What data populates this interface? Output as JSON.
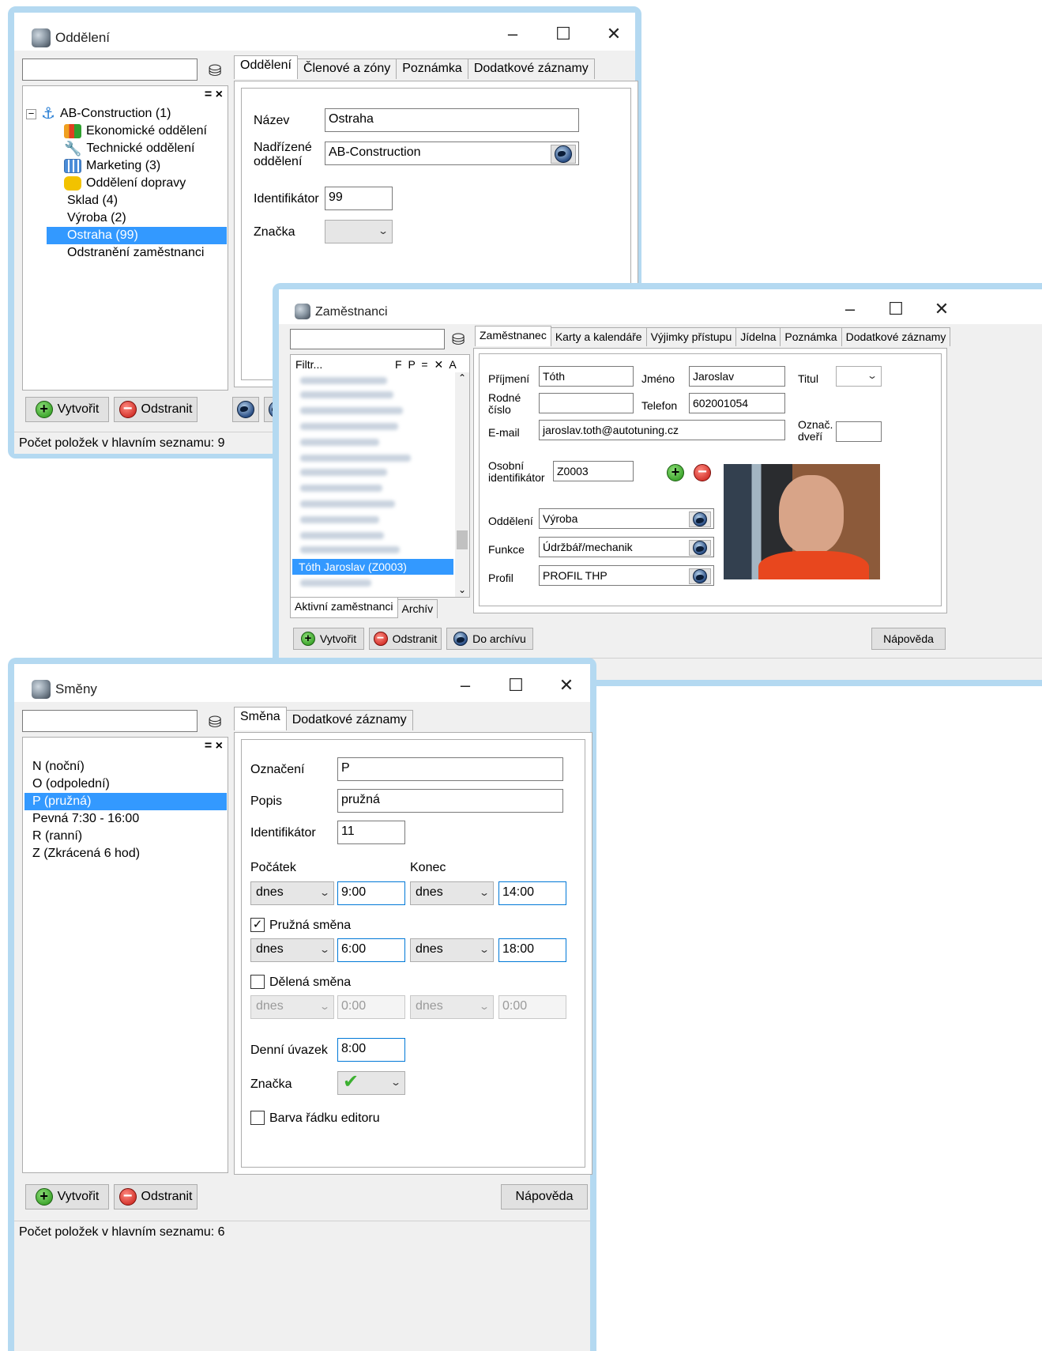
{
  "dept_window": {
    "title": "Oddělení",
    "tabs": [
      "Oddělení",
      "Členové a zóny",
      "Poznámka",
      "Dodatkové záznamy"
    ],
    "tree": [
      {
        "label": "AB-Construction (1)",
        "icon": "anchor-icon"
      },
      {
        "label": "Ekonomické oddělení",
        "icon": "bar-chart-icon"
      },
      {
        "label": "Technické oddělení",
        "icon": "tools-icon"
      },
      {
        "label": "Marketing (3)",
        "icon": "calendar-icon"
      },
      {
        "label": "Oddělení dopravy",
        "icon": "bus-icon"
      },
      {
        "label": "Sklad (4)",
        "icon": ""
      },
      {
        "label": "Výroba (2)",
        "icon": ""
      },
      {
        "label": "Ostraha (99)",
        "icon": "",
        "selected": true
      },
      {
        "label": "Odstranění zaměstnanci",
        "icon": ""
      }
    ],
    "list_controls": "= ×",
    "form": {
      "name_label": "Název",
      "name_value": "Ostraha",
      "parent_label_1": "Nadřízené",
      "parent_label_2": "oddělení",
      "parent_value": "AB-Construction",
      "id_label": "Identifikátor",
      "id_value": "99",
      "mark_label": "Značka"
    },
    "create_button": "Vytvořit",
    "delete_button": "Odstranit",
    "status": "Počet položek v hlavním seznamu: 9"
  },
  "emp_window": {
    "title": "Zaměstnanci",
    "tabs": [
      "Zaměstnanec",
      "Karty a kalendáře",
      "Výjimky přístupu",
      "Jídelna",
      "Poznámka",
      "Dodatkové záznamy"
    ],
    "filter_label": "Filtr...",
    "filter_controls": "F P = ✕ A",
    "selected_employee": "Tóth Jaroslav (Z0003)",
    "list_tabs": [
      "Aktivní zaměstnanci",
      "Archív"
    ],
    "form": {
      "surname_label": "Příjmení",
      "surname_value": "Tóth",
      "firstname_label": "Jméno",
      "firstname_value": "Jaroslav",
      "title_label": "Titul",
      "birth_label_1": "Rodné",
      "birth_label_2": "číslo",
      "birth_value": "",
      "phone_label": "Telefon",
      "phone_value": "602001054",
      "email_label": "E-mail",
      "email_value": "jaroslav.toth@autotuning.cz",
      "door_label_1": "Označ.",
      "door_label_2": "dveří",
      "door_value": "",
      "pid_label_1": "Osobní",
      "pid_label_2": "identifikátor",
      "pid_value": "Z0003",
      "dept_label": "Oddělení",
      "dept_value": "Výroba",
      "func_label": "Funkce",
      "func_value": "Údržbář/mechanik",
      "profile_label": "Profil",
      "profile_value": "PROFIL THP"
    },
    "create_button": "Vytvořit",
    "delete_button": "Odstranit",
    "archive_button": "Do archívu",
    "help_button": "Nápověda"
  },
  "shift_window": {
    "title": "Směny",
    "tabs": [
      "Směna",
      "Dodatkové záznamy"
    ],
    "list_controls": "= ×",
    "items": [
      {
        "label": "N (noční)"
      },
      {
        "label": "O (odpolední)"
      },
      {
        "label": "P (pružná)",
        "selected": true
      },
      {
        "label": "Pevná 7:30 - 16:00"
      },
      {
        "label": "R (ranní)"
      },
      {
        "label": "Z (Zkrácená 6 hod)"
      }
    ],
    "form": {
      "code_label": "Označení",
      "code_value": "P",
      "desc_label": "Popis",
      "desc_value": "pružná",
      "id_label": "Identifikátor",
      "id_value": "11",
      "start_label": "Počátek",
      "end_label": "Konec",
      "start_day": "dnes",
      "start_time": "9:00",
      "end_day": "dnes",
      "end_time": "14:00",
      "flex_label": "Pružná směna",
      "flex_checked": true,
      "flex_start_day": "dnes",
      "flex_start_time": "6:00",
      "flex_end_day": "dnes",
      "flex_end_time": "18:00",
      "split_label": "Dělená směna",
      "split_checked": false,
      "split_start_day": "dnes",
      "split_start_time": "0:00",
      "split_end_day": "dnes",
      "split_end_time": "0:00",
      "daily_label": "Denní úvazek",
      "daily_value": "8:00",
      "mark_label": "Značka",
      "row_color_label": "Barva řádku editoru"
    },
    "create_button": "Vytvořit",
    "delete_button": "Odstranit",
    "help_button": "Nápověda",
    "status": "Počet položek v hlavním seznamu: 6"
  }
}
